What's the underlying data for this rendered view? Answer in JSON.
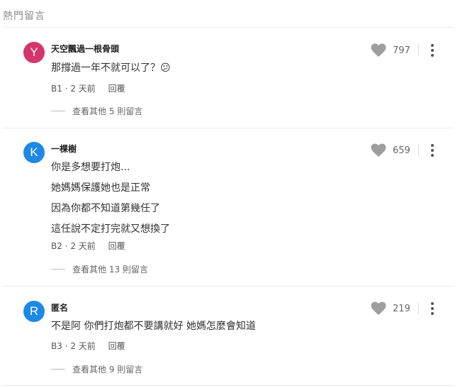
{
  "section_title": "熱門留言",
  "colors": {
    "avatar_y": "#d4356b",
    "avatar_k": "#1e88e5",
    "avatar_r": "#1e88e5",
    "like_icon": "#9e9e9e"
  },
  "comments": [
    {
      "avatar_letter": "Y",
      "author": "天空飄過一根骨頭",
      "lines": [
        "那撐過一年不就可以了？😕"
      ],
      "floor": "B1",
      "time": "2 天前",
      "reply_label": "回覆",
      "more_replies": "查看其他 5 則留言",
      "likes": "797",
      "like_icon": "heart-icon",
      "menu_icon": "more-vertical-icon"
    },
    {
      "avatar_letter": "K",
      "author": "一棵樹",
      "lines": [
        "你是多想要打炮...",
        "她媽媽保護她也是正常",
        "因為你都不知道第幾任了",
        "這任說不定打完就又想換了"
      ],
      "floor": "B2",
      "time": "2 天前",
      "reply_label": "回覆",
      "more_replies": "查看其他 13 則留言",
      "likes": "659",
      "like_icon": "heart-icon",
      "menu_icon": "more-vertical-icon"
    },
    {
      "avatar_letter": "R",
      "author": "匿名",
      "lines": [
        "不是阿 你們打炮都不要講就好 她媽怎麼會知道"
      ],
      "floor": "B3",
      "time": "2 天前",
      "reply_label": "回覆",
      "more_replies": "查看其他 9 則留言",
      "likes": "219",
      "like_icon": "heart-icon",
      "menu_icon": "more-vertical-icon"
    }
  ]
}
